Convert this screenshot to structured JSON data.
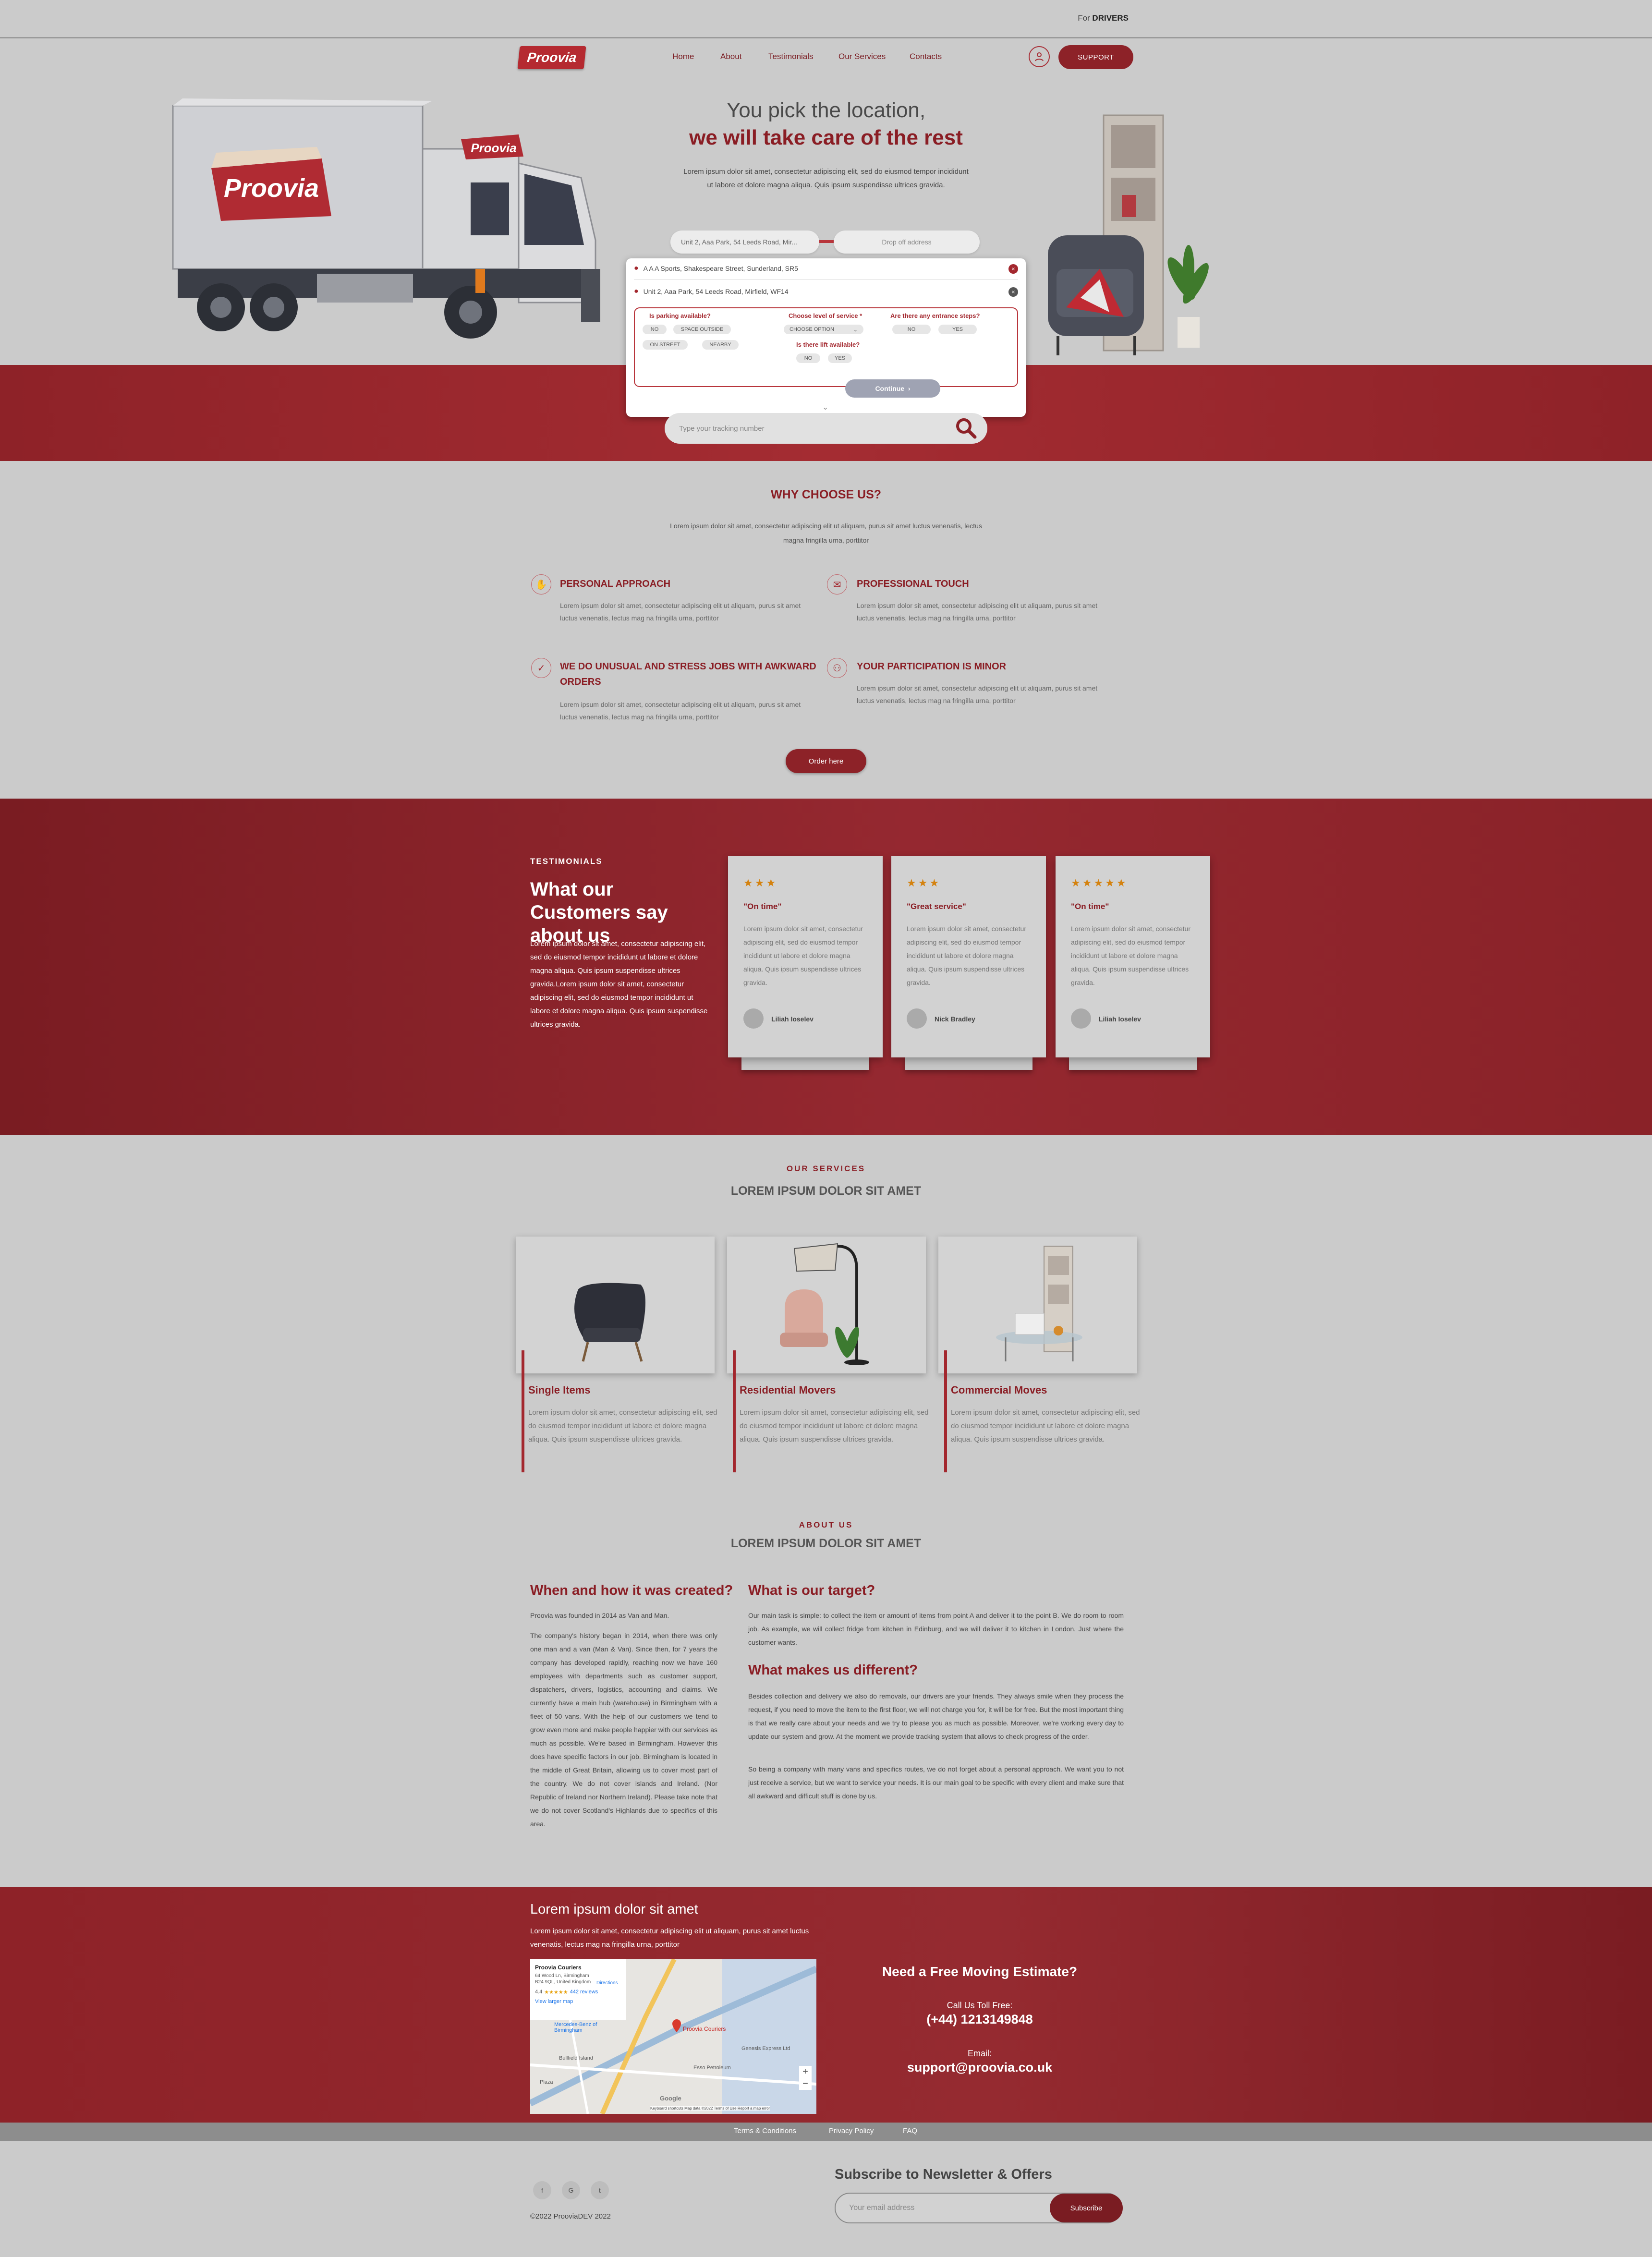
{
  "topbar": {
    "for": "For",
    "drivers": "DRIVERS"
  },
  "brand": {
    "logo": "Proovia",
    "truck_logo": "Proovia",
    "accent": "#8c2127"
  },
  "nav": {
    "items": [
      "Home",
      "About",
      "Testimonials",
      "Our Services",
      "Contacts"
    ],
    "support": "SUPPORT",
    "user_icon": "user-icon"
  },
  "hero": {
    "line1": "You pick the location,",
    "line2": "we will take care of the rest",
    "desc": "Lorem ipsum dolor sit amet, consectetur adipiscing elit, sed do eiusmod tempor incididunt ut labore et dolore magna aliqua. Quis ipsum suspendisse ultrices gravida."
  },
  "booking": {
    "pickup_value": "Unit 2, Aaa Park, 54 Leeds Road, Mir...",
    "dropoff_placeholder": "Drop off address",
    "address1": "A A A Sports, Shakespeare Street, Sunderland, SR5",
    "address2": "Unit 2, Aaa Park, 54 Leeds Road, Mirfield, WF14",
    "q_parking": "Is parking available?",
    "parking_options": [
      "NO",
      "SPACE OUTSIDE",
      "ON STREET",
      "NEARBY"
    ],
    "q_service": "Choose level of service *",
    "service_select": "CHOOSE OPTION",
    "q_steps": "Are there any entrance steps?",
    "steps_options": [
      "NO",
      "YES"
    ],
    "q_lift": "Is there lift available?",
    "lift_options": [
      "NO",
      "YES"
    ],
    "continue": "Continue"
  },
  "tracking": {
    "placeholder": "Type your tracking number"
  },
  "why": {
    "title": "WHY CHOOSE US?",
    "desc": "Lorem ipsum dolor sit amet, consectetur adipiscing elit ut aliquam, purus sit amet luctus venenatis, lectus magna fringilla urna, porttitor",
    "features": [
      {
        "title": "PERSONAL APPROACH",
        "text": "Lorem ipsum dolor sit amet, consectetur adipiscing elit ut aliquam, purus sit amet luctus venenatis, lectus mag na fringilla urna, porttitor"
      },
      {
        "title": "PROFESSIONAL TOUCH",
        "text": "Lorem ipsum dolor sit amet, consectetur adipiscing elit ut aliquam, purus sit amet luctus venenatis, lectus mag na fringilla urna, porttitor"
      },
      {
        "title": "WE DO UNUSUAL AND STRESS JOBS WITH AWKWARD ORDERS",
        "text": "Lorem ipsum dolor sit amet, consectetur adipiscing elit ut aliquam, purus sit amet luctus venenatis, lectus mag na fringilla urna, porttitor"
      },
      {
        "title": "YOUR PARTICIPATION IS MINOR",
        "text": "Lorem ipsum dolor sit amet, consectetur adipiscing elit ut aliquam, purus sit amet luctus venenatis, lectus mag na fringilla urna, porttitor"
      }
    ],
    "order_button": "Order here"
  },
  "testimonials": {
    "label": "TESTIMONIALS",
    "heading": "What our Customers say about us",
    "desc": "Lorem ipsum dolor sit amet, consectetur adipiscing elit, sed do eiusmod tempor incididunt ut labore et dolore magna aliqua. Quis ipsum suspendisse ultrices gravida.Lorem ipsum dolor sit amet, consectetur adipiscing elit, sed do eiusmod tempor incididunt ut labore et dolore magna aliqua. Quis ipsum suspendisse ultrices gravida.",
    "cards": [
      {
        "stars": "★★★",
        "rating": 3,
        "title": "\"On time\"",
        "text": "Lorem ipsum dolor sit amet, consectetur adipiscing elit, sed do eiusmod tempor incididunt ut labore et dolore magna aliqua. Quis ipsum suspendisse ultrices gravida.",
        "name": "Liliah Ioselev"
      },
      {
        "stars": "★★★",
        "rating": 3,
        "title": "\"Great service\"",
        "text": "Lorem ipsum dolor sit amet, consectetur adipiscing elit, sed do eiusmod tempor incididunt ut labore et dolore magna aliqua. Quis ipsum suspendisse ultrices gravida.",
        "name": "Nick Bradley"
      },
      {
        "stars": "★★★★★",
        "rating": 5,
        "title": "\"On time\"",
        "text": "Lorem ipsum dolor sit amet, consectetur adipiscing elit, sed do eiusmod tempor incididunt ut labore et dolore magna aliqua. Quis ipsum suspendisse ultrices gravida.",
        "name": "Liliah Ioselev"
      }
    ]
  },
  "services": {
    "label": "OUR SERVICES",
    "heading": "LOREM IPSUM DOLOR SIT AMET",
    "items": [
      {
        "title": "Single Items",
        "text": "Lorem ipsum dolor sit amet, consectetur adipiscing elit, sed do eiusmod tempor incididunt ut labore et dolore magna aliqua. Quis ipsum suspendisse ultrices gravida."
      },
      {
        "title": "Residential Movers",
        "text": "Lorem ipsum dolor sit amet, consectetur adipiscing elit, sed do eiusmod tempor incididunt ut labore et dolore magna aliqua. Quis ipsum suspendisse ultrices gravida."
      },
      {
        "title": "Commercial Moves",
        "text": "Lorem ipsum dolor sit amet, consectetur adipiscing elit, sed do eiusmod tempor incididunt ut labore et dolore magna aliqua. Quis ipsum suspendisse ultrices gravida."
      }
    ]
  },
  "about": {
    "label": "ABOUT US",
    "heading": "LOREM IPSUM DOLOR SIT AMET",
    "h1": "When and how it was created?",
    "p1a": "Proovia was founded in 2014 as Van and Man.",
    "p1b": "The company's history began in 2014, when there was only one man and a van (Man & Van). Since then, for 7 years the company has developed rapidly, reaching now we have 160 employees with departments such as customer support, dispatchers, drivers, logistics, accounting and claims. We currently have a main hub (warehouse) in Birmingham with a fleet of 50 vans. With the help of our customers we tend to grow even more and make people happier with our services as much as possible. We're based in Birmingham. However this does have specific factors in our job. Birmingham is located in the middle of Great Britain, allowing us to cover most part of the country. We do not cover islands and Ireland. (Nor Republic of Ireland nor Northern Ireland). Please take note that we do not cover Scotland's Highlands due to specifics of this area.",
    "h2": "What is our target?",
    "p2": "Our main task is simple: to collect the item or amount of items from point A and deliver it to the point B. We do room to room job. As example, we will collect fridge from kitchen in Edinburg, and we will deliver it to kitchen in London. Just where the customer wants.",
    "h3": "What makes us different?",
    "p3a": "Besides collection and delivery we also do removals, our drivers are your friends. They always smile when they process the request, if you need to move the item to the first floor, we will not charge you for, it will be for free. But the most important thing is that we really care about your needs and we try to please you as much as possible. Moreover, we're working every day to update our system and grow. At the moment we provide tracking system that allows to check progress of the order.",
    "p3b": "So being a company with many vans and specifics routes, we do not forget about a personal approach. We want you to not just receive a service, but we want to service your needs. It is our main goal to be specific with every client and make sure that all awkward and difficult stuff is done by us."
  },
  "footer": {
    "heading": "Lorem ipsum dolor sit amet",
    "desc": "Lorem ipsum dolor sit amet, consectetur adipiscing elit ut aliquam, purus sit amet luctus venenatis, lectus mag na fringilla urna, porttitor",
    "map": {
      "place": "Proovia Couriers",
      "address": "64 Wood Ln, Birmingham B24 9QL, United Kingdom",
      "rating": "4.4",
      "stars": "★★★★★",
      "reviews": "442 reviews",
      "larger": "View larger map",
      "directions": "Directions",
      "pin_label": "Proovia Couriers",
      "labels": [
        "Mercedes-Benz of Birmingham",
        "Genesis Express Ltd",
        "Esso Petroleum",
        "Bullfield Island",
        "Plaza",
        "Google"
      ],
      "footer_text": "Keyboard shortcuts   Map data ©2022   Terms of Use   Report a map error"
    },
    "estimate": "Need a Free Moving Estimate?",
    "call_label": "Call Us Toll Free:",
    "phone": "(+44) 1213149848",
    "email_label": "Email:",
    "email": "support@proovia.co.uk",
    "links": [
      "Terms & Conditions",
      "Privacy Policy",
      "FAQ"
    ],
    "social": [
      "facebook-icon",
      "google-icon",
      "twitter-icon"
    ],
    "copyright": "©2022 ProoviaDEV 2022",
    "newsletter_title": "Subscribe to Newsletter & Offers",
    "email_placeholder": "Your email address",
    "subscribe": "Subscribe"
  }
}
